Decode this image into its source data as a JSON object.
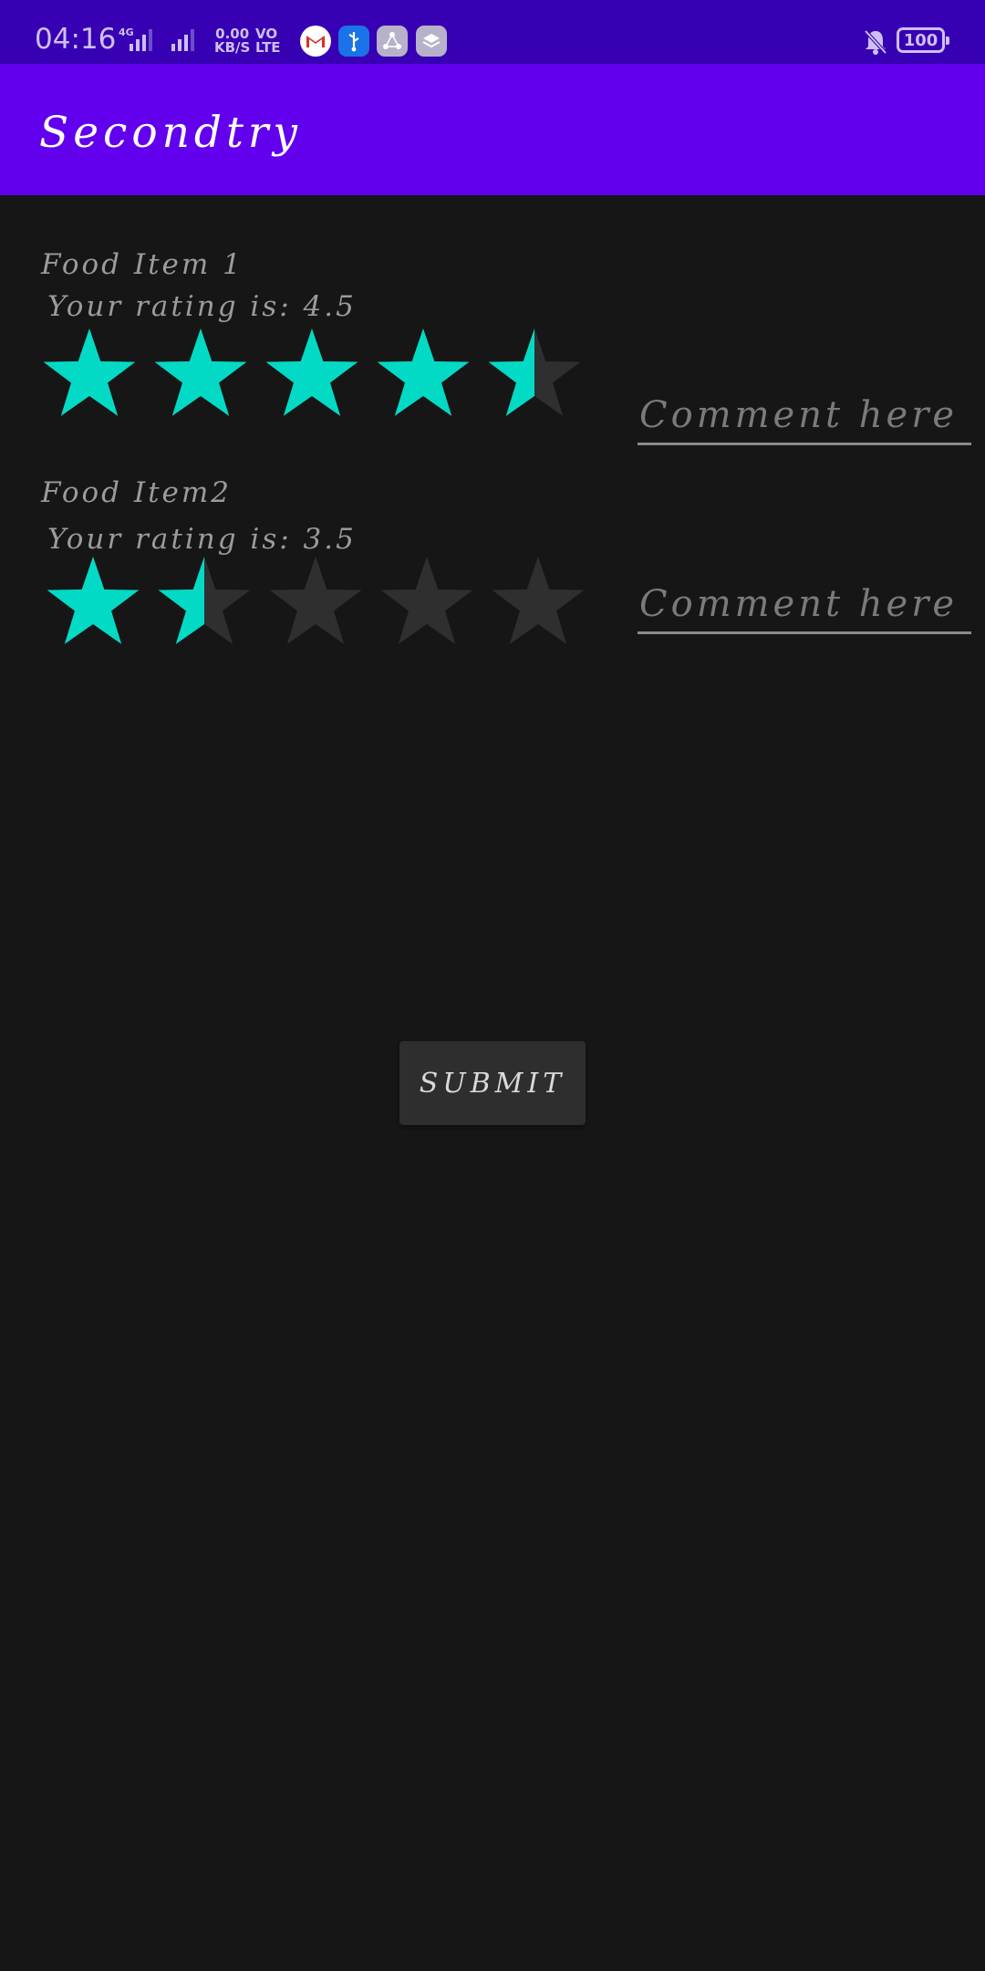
{
  "status_bar": {
    "time": "04:16",
    "network_label": "4G",
    "net_speed_value": "0.00",
    "net_speed_unit": "KB/S",
    "volte_line1": "VO",
    "volte_line2": "LTE",
    "battery": "100",
    "icons": [
      "gmail-icon",
      "usb-icon",
      "app-icon",
      "layers-icon",
      "bell-off-icon"
    ]
  },
  "app_bar": {
    "title": "Secondtry"
  },
  "items": [
    {
      "name": "Food Item 1",
      "rating_text": "Your rating is: 4.5",
      "rating": 4.5,
      "max_rating": 5,
      "comment_placeholder": "Comment here",
      "comment_value": ""
    },
    {
      "name": "Food Item2",
      "rating_text": "Your rating is: 3.5",
      "rating": 1.5,
      "max_rating": 5,
      "comment_placeholder": "Comment here",
      "comment_value": ""
    }
  ],
  "submit_label": "SUBMIT",
  "colors": {
    "status_bar": "#3700b3",
    "app_bar": "#6200ee",
    "background": "#161616",
    "star_filled": "#03dac5",
    "star_empty": "#2f2f2f"
  }
}
